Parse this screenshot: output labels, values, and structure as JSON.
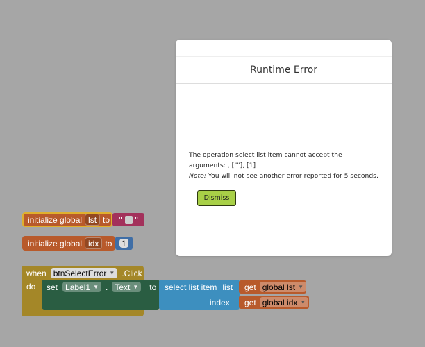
{
  "dialog": {
    "title": "Runtime Error",
    "message_line1": "The operation select list item cannot accept the",
    "message_line2": "arguments: , [\"\"], [1]",
    "note_label": "Note:",
    "note_text": " You will not see another error reported for 5 seconds.",
    "dismiss_label": "Dismiss"
  },
  "blocks": {
    "init_lst": {
      "prefix": "initialize global",
      "var": "lst",
      "to": "to",
      "open_quote": "\"",
      "close_quote": "\""
    },
    "init_idx": {
      "prefix": "initialize global",
      "var": "idx",
      "to": "to",
      "number": "1"
    },
    "event": {
      "when": "when",
      "component": "btnSelectError",
      "event_suffix": ".Click",
      "do": "do",
      "set": "set",
      "target_component": "Label1",
      "dot": ".",
      "property": "Text",
      "to": "to",
      "select_label": "select list item",
      "list_label": "list",
      "index_label": "index",
      "get1": "get",
      "get1_var": "global lst",
      "get2": "get",
      "get2_var": "global idx"
    }
  },
  "colors": {
    "workspace": "#a6a6a6",
    "variable_block": "#b85a2b",
    "text_block": "#a3315b",
    "math_block": "#3f6ea6",
    "event_block": "#a48728",
    "component_block": "#2a5d42",
    "list_block": "#3d8fbf",
    "dismiss_button": "#a8d047"
  }
}
